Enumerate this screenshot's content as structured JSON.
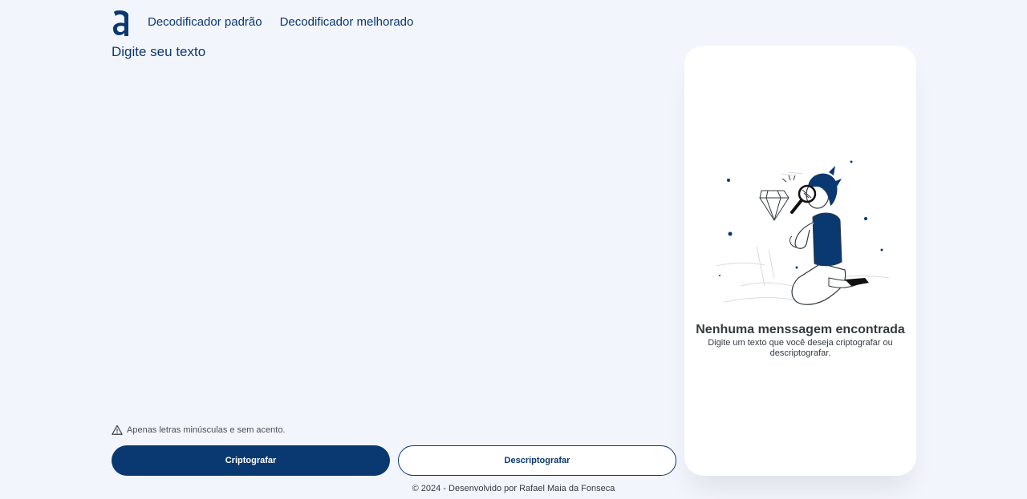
{
  "nav": {
    "logo_icon": "alura-logo-icon",
    "items": [
      {
        "label": "Decodificador padrão"
      },
      {
        "label": "Decodificador melhorado"
      }
    ]
  },
  "input": {
    "placeholder": "Digite seu texto",
    "value": ""
  },
  "hint": {
    "icon": "warning-icon",
    "text": "Apenas letras minúsculas e sem acento."
  },
  "buttons": {
    "encrypt": "Criptografar",
    "decrypt": "Descriptografar"
  },
  "output": {
    "illustration": "person-with-magnifier-illustration",
    "title": "Nenhuma menssagem encontrada",
    "text": "Digite um texto que você deseja criptografar ou descriptografar."
  },
  "footer": {
    "text": "© 2024 - Desenvolvido por Rafael Maia da Fonseca"
  },
  "colors": {
    "primary": "#0a3871",
    "background": "#f3f5fc",
    "panel": "#ffffff",
    "text_dark": "#343a40"
  }
}
